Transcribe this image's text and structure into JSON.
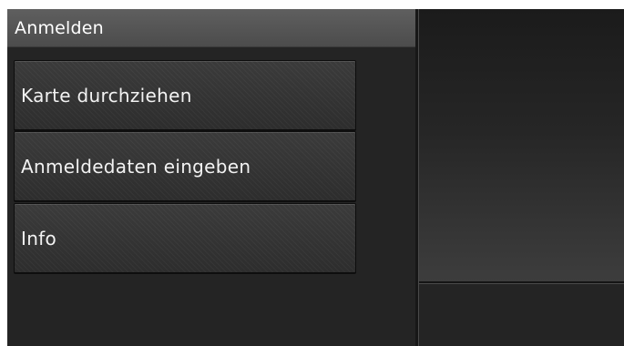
{
  "header": {
    "title": "Anmelden"
  },
  "menu": {
    "items": [
      {
        "label": "Karte durchziehen"
      },
      {
        "label": "Anmeldedaten eingeben"
      },
      {
        "label": "Info"
      }
    ]
  },
  "colors": {
    "background": "#222222",
    "titlebar": "#555555",
    "button": "#343434",
    "text": "#ffffff"
  }
}
